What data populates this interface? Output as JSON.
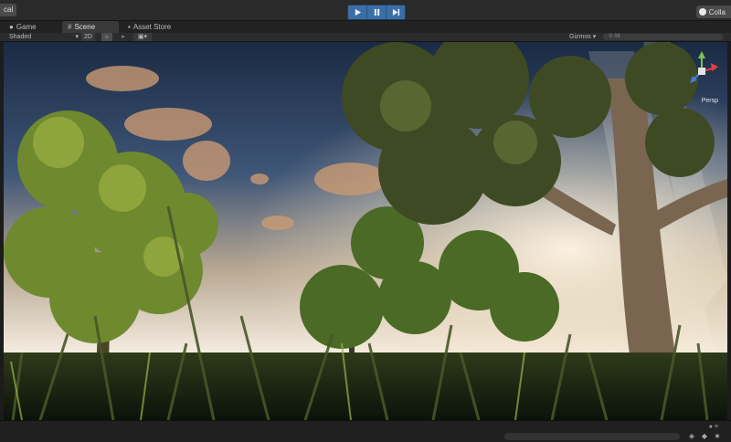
{
  "top_bar": {
    "layout_label": "cal",
    "play_controls": [
      {
        "icon": "play-icon"
      },
      {
        "icon": "pause-icon"
      },
      {
        "icon": "step-icon"
      }
    ],
    "collab_label": "Colla",
    "accent_color": "#3b6ea5"
  },
  "tabs": [
    {
      "label": "Game",
      "icon": "game-icon",
      "active": false
    },
    {
      "label": "Scene",
      "icon": "scene-grid-icon",
      "active": true
    },
    {
      "label": "Asset Store",
      "icon": "asset-store-icon",
      "active": false
    }
  ],
  "scene_toolbar": {
    "shading_mode": "Shaded",
    "mode_2d": "2D",
    "gizmos_label": "Gizmos",
    "search_placeholder": "All"
  },
  "viewport": {
    "projection_label": "Persp",
    "scene_description_icon": "forest-scene"
  }
}
